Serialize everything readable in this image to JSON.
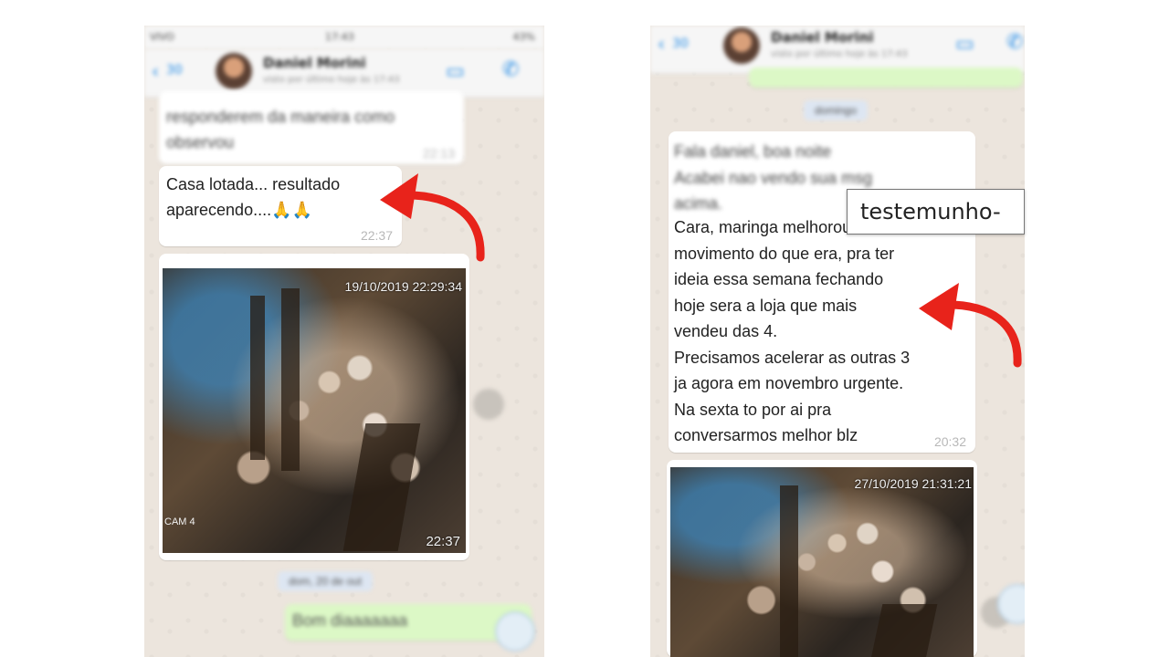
{
  "left_screen": {
    "status": {
      "carrier": "VIVO",
      "time": "17:43",
      "battery": "43%"
    },
    "header": {
      "back_count": "30",
      "name": "Daniel Morini",
      "status": "visto por último hoje às 17:43"
    },
    "msg_prev": {
      "text": "responderem da maneira como\nobservou",
      "time": "22:13"
    },
    "msg_main": {
      "text": "Casa lotada... resultado\naparecendo....🙏🙏",
      "time": "22:37"
    },
    "photo": {
      "stamp": "19/10/2019 22:29:34",
      "cam": "CAM 4",
      "time": "22:37"
    },
    "date_pill": "dom, 20 de out",
    "out_msg": {
      "text": "Bom diaaaaaaa"
    }
  },
  "right_screen": {
    "header": {
      "back_count": "30",
      "name": "Daniel Morini",
      "status": "visto por último hoje às 17:43"
    },
    "date_pill": "domingo",
    "msg_blur": {
      "text": "Fala daniel, boa noite\nAcabei nao vendo sua msg\nacima."
    },
    "msg_clear": {
      "text": "Cara, maringa melhorou\nmovimento do que era, pra ter\nideia essa semana fechando\nhoje sera a loja que mais\nvendeu das 4.\nPrecisamos acelerar as outras 3\nja agora em novembro urgente.\nNa sexta to por ai pra\nconversarmos melhor blz",
      "time": "20:32"
    },
    "photo": {
      "stamp": "27/10/2019 21:31:21"
    }
  },
  "overlay_label": "testemunho-",
  "colors": {
    "arrow": "#e8231b",
    "incoming_bubble": "#ffffff",
    "outgoing_bubble": "#dcf8c6",
    "chat_bg": "#ece5dd",
    "ios_blue": "#1e88e5"
  },
  "icons": [
    "back-chevron-icon",
    "video-call-icon",
    "phone-call-icon",
    "share-icon",
    "red-arrow-icon"
  ]
}
